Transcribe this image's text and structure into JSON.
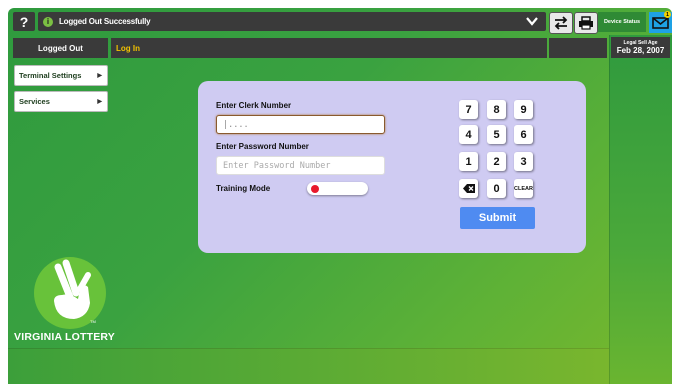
{
  "topbar": {
    "help_label": "?",
    "info_icon": "info-icon",
    "status_message": "Logged Out Successfully",
    "device_status_label": "Device Status",
    "mail_badge": "1",
    "icons": [
      "chevron-down-icon",
      "swap-arrows-icon",
      "printer-icon",
      "mail-icon"
    ]
  },
  "subbar": {
    "logged_out_label": "Logged Out",
    "login_link": "Log In",
    "legal_sell_age_label": "Legal Sell Age",
    "legal_sell_age_date": "Feb 28, 2007"
  },
  "sidebar": {
    "items": [
      {
        "label": "Terminal Settings"
      },
      {
        "label": "Services"
      }
    ]
  },
  "login_form": {
    "clerk_label": "Enter Clerk Number",
    "clerk_value": "|....",
    "password_label": "Enter Password Number",
    "password_placeholder": "Enter Password Number",
    "training_mode_label": "Training Mode",
    "training_mode_on": false,
    "submit_label": "Submit"
  },
  "keypad": {
    "keys": [
      "7",
      "8",
      "9",
      "4",
      "5",
      "6",
      "1",
      "2",
      "3",
      "⌫",
      "0",
      "CLEAR"
    ]
  },
  "branding": {
    "logo_text": "VIRGINIA LOTTERY",
    "tm": "TM"
  },
  "colors": {
    "accent_green": "#3aa240",
    "submit_blue": "#4f8bf1",
    "panel_lavender": "#cfcbf2",
    "link_yellow": "#f2c200",
    "mail_blue": "#1ea2e5"
  }
}
